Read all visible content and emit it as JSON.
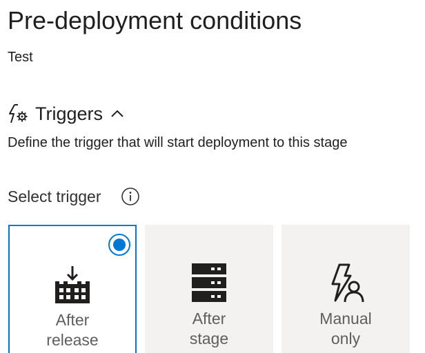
{
  "page": {
    "title": "Pre-deployment conditions",
    "stage_name": "Test"
  },
  "triggers": {
    "icon": "trigger-icon",
    "title": "Triggers",
    "expanded": true,
    "chevron_icon": "chevron-up-icon",
    "description": "Define the trigger that will start deployment to this stage",
    "select_label": "Select trigger",
    "info_icon": "info-icon",
    "options": [
      {
        "line1": "After",
        "line2": "release",
        "icon": "after-release-icon",
        "selected": true
      },
      {
        "line1": "After",
        "line2": "stage",
        "icon": "after-stage-icon",
        "selected": false
      },
      {
        "line1": "Manual",
        "line2": "only",
        "icon": "manual-only-icon",
        "selected": false
      }
    ]
  },
  "colors": {
    "accent": "#0078d4",
    "card_background": "#f3f2f1",
    "text": "#201f1e",
    "muted_text": "#605e5c"
  }
}
